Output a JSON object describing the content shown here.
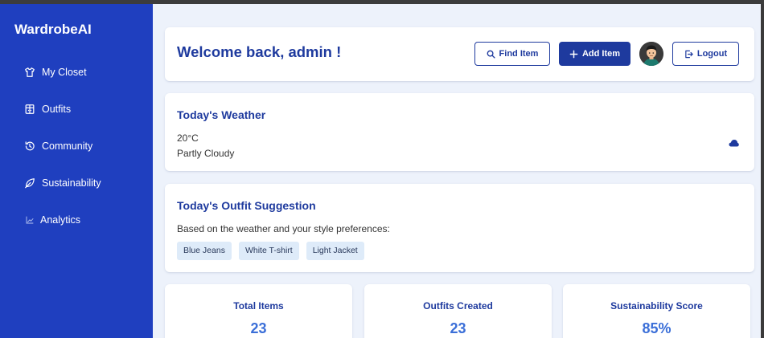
{
  "app": {
    "name": "WardrobeAI"
  },
  "sidebar": {
    "items": [
      {
        "label": "My Closet",
        "icon": "shirt-icon"
      },
      {
        "label": "Outfits",
        "icon": "wardrobe-icon"
      },
      {
        "label": "Community",
        "icon": "history-icon"
      },
      {
        "label": "Sustainability",
        "icon": "leaf-icon"
      },
      {
        "label": "Analytics",
        "icon": "chart-line-icon"
      }
    ]
  },
  "header": {
    "welcome": "Welcome back, admin !",
    "find_label": "Find Item",
    "add_label": "Add Item",
    "logout_label": "Logout"
  },
  "weather": {
    "title": "Today's Weather",
    "temperature": "20°C",
    "condition": "Partly Cloudy",
    "icon": "cloud-icon"
  },
  "outfit": {
    "title": "Today's Outfit Suggestion",
    "subtitle": "Based on the weather and your style preferences:",
    "tags": [
      "Blue Jeans",
      "White T-shirt",
      "Light Jacket"
    ]
  },
  "stats": [
    {
      "label": "Total Items",
      "value": "23"
    },
    {
      "label": "Outfits Created",
      "value": "23"
    },
    {
      "label": "Sustainability Score",
      "value": "85%"
    }
  ],
  "colors": {
    "sidebar": "#1f3fbf",
    "primary": "#1e3a9e",
    "accent": "#3b6fd8",
    "background": "#edf2fb",
    "tag": "#deebf9"
  }
}
